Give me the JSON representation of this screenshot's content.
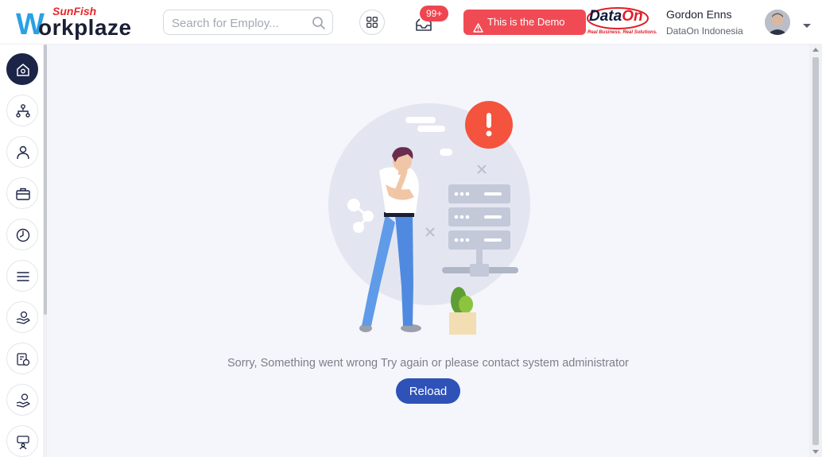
{
  "brand": {
    "top": "SunFish",
    "w": "W",
    "rest": "orkplaze"
  },
  "search": {
    "placeholder": "Search for Employ..."
  },
  "notifications": {
    "count": "99+"
  },
  "demo_banner": {
    "label": "This is the Demo"
  },
  "partner_logo": {
    "name_main": "Data",
    "name_accent": "On",
    "tagline": "Real Business. Real Solutions."
  },
  "user": {
    "name": "Gordon Enns",
    "company": "DataOn Indonesia"
  },
  "sidebar": {
    "items": [
      {
        "name": "home-icon",
        "active": true
      },
      {
        "name": "org-chart-icon",
        "active": false
      },
      {
        "name": "person-icon",
        "active": false
      },
      {
        "name": "briefcase-icon",
        "active": false
      },
      {
        "name": "clock-icon",
        "active": false
      },
      {
        "name": "menu-icon",
        "active": false
      },
      {
        "name": "hand-money-icon",
        "active": false
      },
      {
        "name": "document-money-icon",
        "active": false
      },
      {
        "name": "hand-coin-icon",
        "active": false
      },
      {
        "name": "presenter-icon",
        "active": false
      }
    ]
  },
  "error": {
    "message": "Sorry, Something went wrong Try again or please contact system administrator",
    "reload_label": "Reload"
  },
  "colors": {
    "accent": "#2f52b8",
    "danger": "#f04b55",
    "nav_active": "#1c2447",
    "alert": "#f4533d"
  }
}
